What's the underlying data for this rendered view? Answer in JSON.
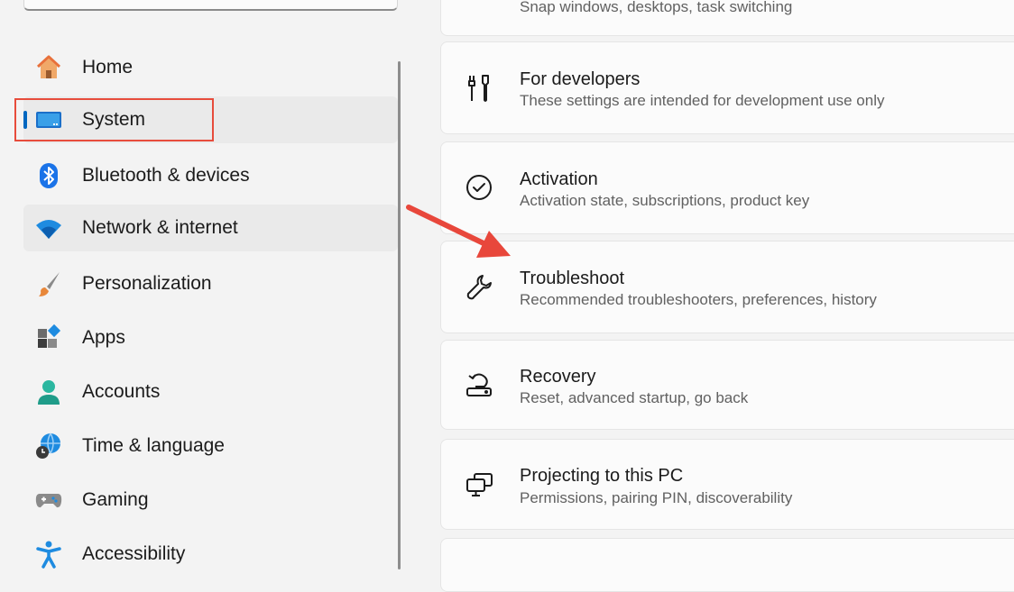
{
  "sidebar": {
    "items": [
      {
        "label": "Home",
        "icon": "home-icon"
      },
      {
        "label": "System",
        "icon": "system-display-icon",
        "selected": true
      },
      {
        "label": "Bluetooth & devices",
        "icon": "bluetooth-icon"
      },
      {
        "label": "Network & internet",
        "icon": "wifi-icon"
      },
      {
        "label": "Personalization",
        "icon": "brush-icon"
      },
      {
        "label": "Apps",
        "icon": "apps-icon"
      },
      {
        "label": "Accounts",
        "icon": "person-icon"
      },
      {
        "label": "Time & language",
        "icon": "globe-clock-icon"
      },
      {
        "label": "Gaming",
        "icon": "gamepad-icon"
      },
      {
        "label": "Accessibility",
        "icon": "accessibility-icon"
      }
    ]
  },
  "main": {
    "partial_top_subtitle": "Snap windows, desktops, task switching",
    "cards": [
      {
        "title": "For developers",
        "subtitle": "These settings are intended for development use only",
        "icon": "developer-tools-icon"
      },
      {
        "title": "Activation",
        "subtitle": "Activation state, subscriptions, product key",
        "icon": "check-circle-icon"
      },
      {
        "title": "Troubleshoot",
        "subtitle": "Recommended troubleshooters, preferences, history",
        "icon": "wrench-icon"
      },
      {
        "title": "Recovery",
        "subtitle": "Reset, advanced startup, go back",
        "icon": "recovery-icon"
      },
      {
        "title": "Projecting to this PC",
        "subtitle": "Permissions, pairing PIN, discoverability",
        "icon": "projecting-icon"
      }
    ]
  },
  "colors": {
    "highlight_box": "#e74c3c",
    "annotation_arrow": "#e8473b",
    "accent": "#0067c0"
  }
}
